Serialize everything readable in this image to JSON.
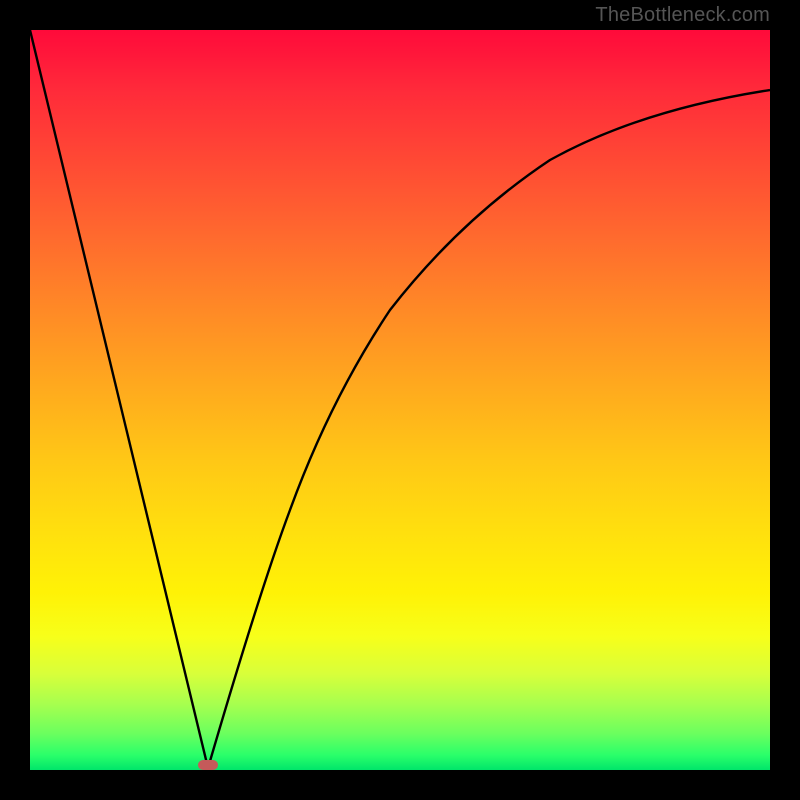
{
  "attribution": "TheBottleneck.com",
  "colors": {
    "frame_bg": "#000000",
    "marker": "#c55a5a",
    "curve": "#000000"
  },
  "chart_data": {
    "type": "line",
    "title": "",
    "xlabel": "",
    "ylabel": "",
    "xlim": [
      0,
      100
    ],
    "ylim": [
      0,
      100
    ],
    "grid": false,
    "legend": false,
    "series": [
      {
        "name": "left-branch",
        "x": [
          0,
          24
        ],
        "y": [
          100,
          0
        ]
      },
      {
        "name": "right-branch",
        "x": [
          24,
          28,
          32,
          36,
          40,
          45,
          50,
          55,
          60,
          66,
          72,
          80,
          88,
          95,
          100
        ],
        "y": [
          0,
          14,
          25,
          34,
          42,
          50,
          57,
          63,
          68,
          73,
          77,
          81,
          84,
          86,
          88
        ]
      }
    ],
    "marker": {
      "x": 24,
      "y": 0,
      "shape": "rounded-rect"
    }
  }
}
